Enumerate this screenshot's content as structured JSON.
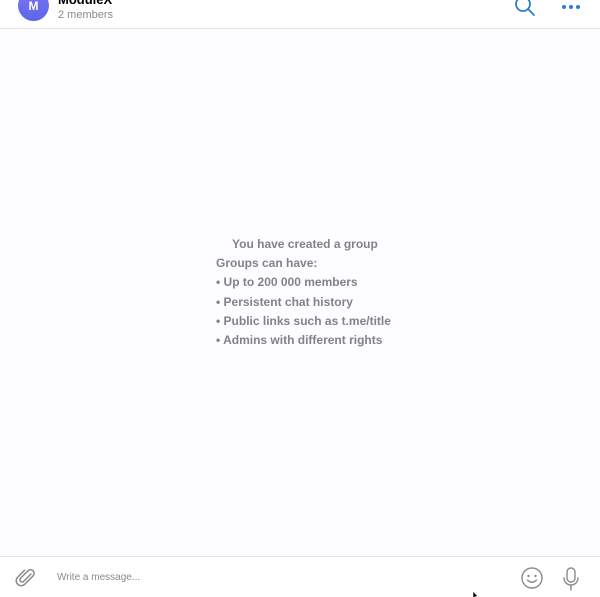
{
  "header": {
    "avatar_letter": "M",
    "title": "ModuleX",
    "subtitle": "2 members",
    "search_icon": "search-icon",
    "more_icon": "more-dots-icon",
    "accent_color": "#2e7bcf"
  },
  "service_message": {
    "title": "You have created a group",
    "intro": "Groups can have:",
    "features": [
      "• Up to 200 000 members",
      "• Persistent chat history",
      "• Public links such as t.me/title",
      "• Admins with different rights"
    ]
  },
  "composer": {
    "placeholder": "Write a message...",
    "attach_icon": "paperclip-icon",
    "emoji_icon": "emoji-icon",
    "mic_icon": "microphone-icon"
  }
}
